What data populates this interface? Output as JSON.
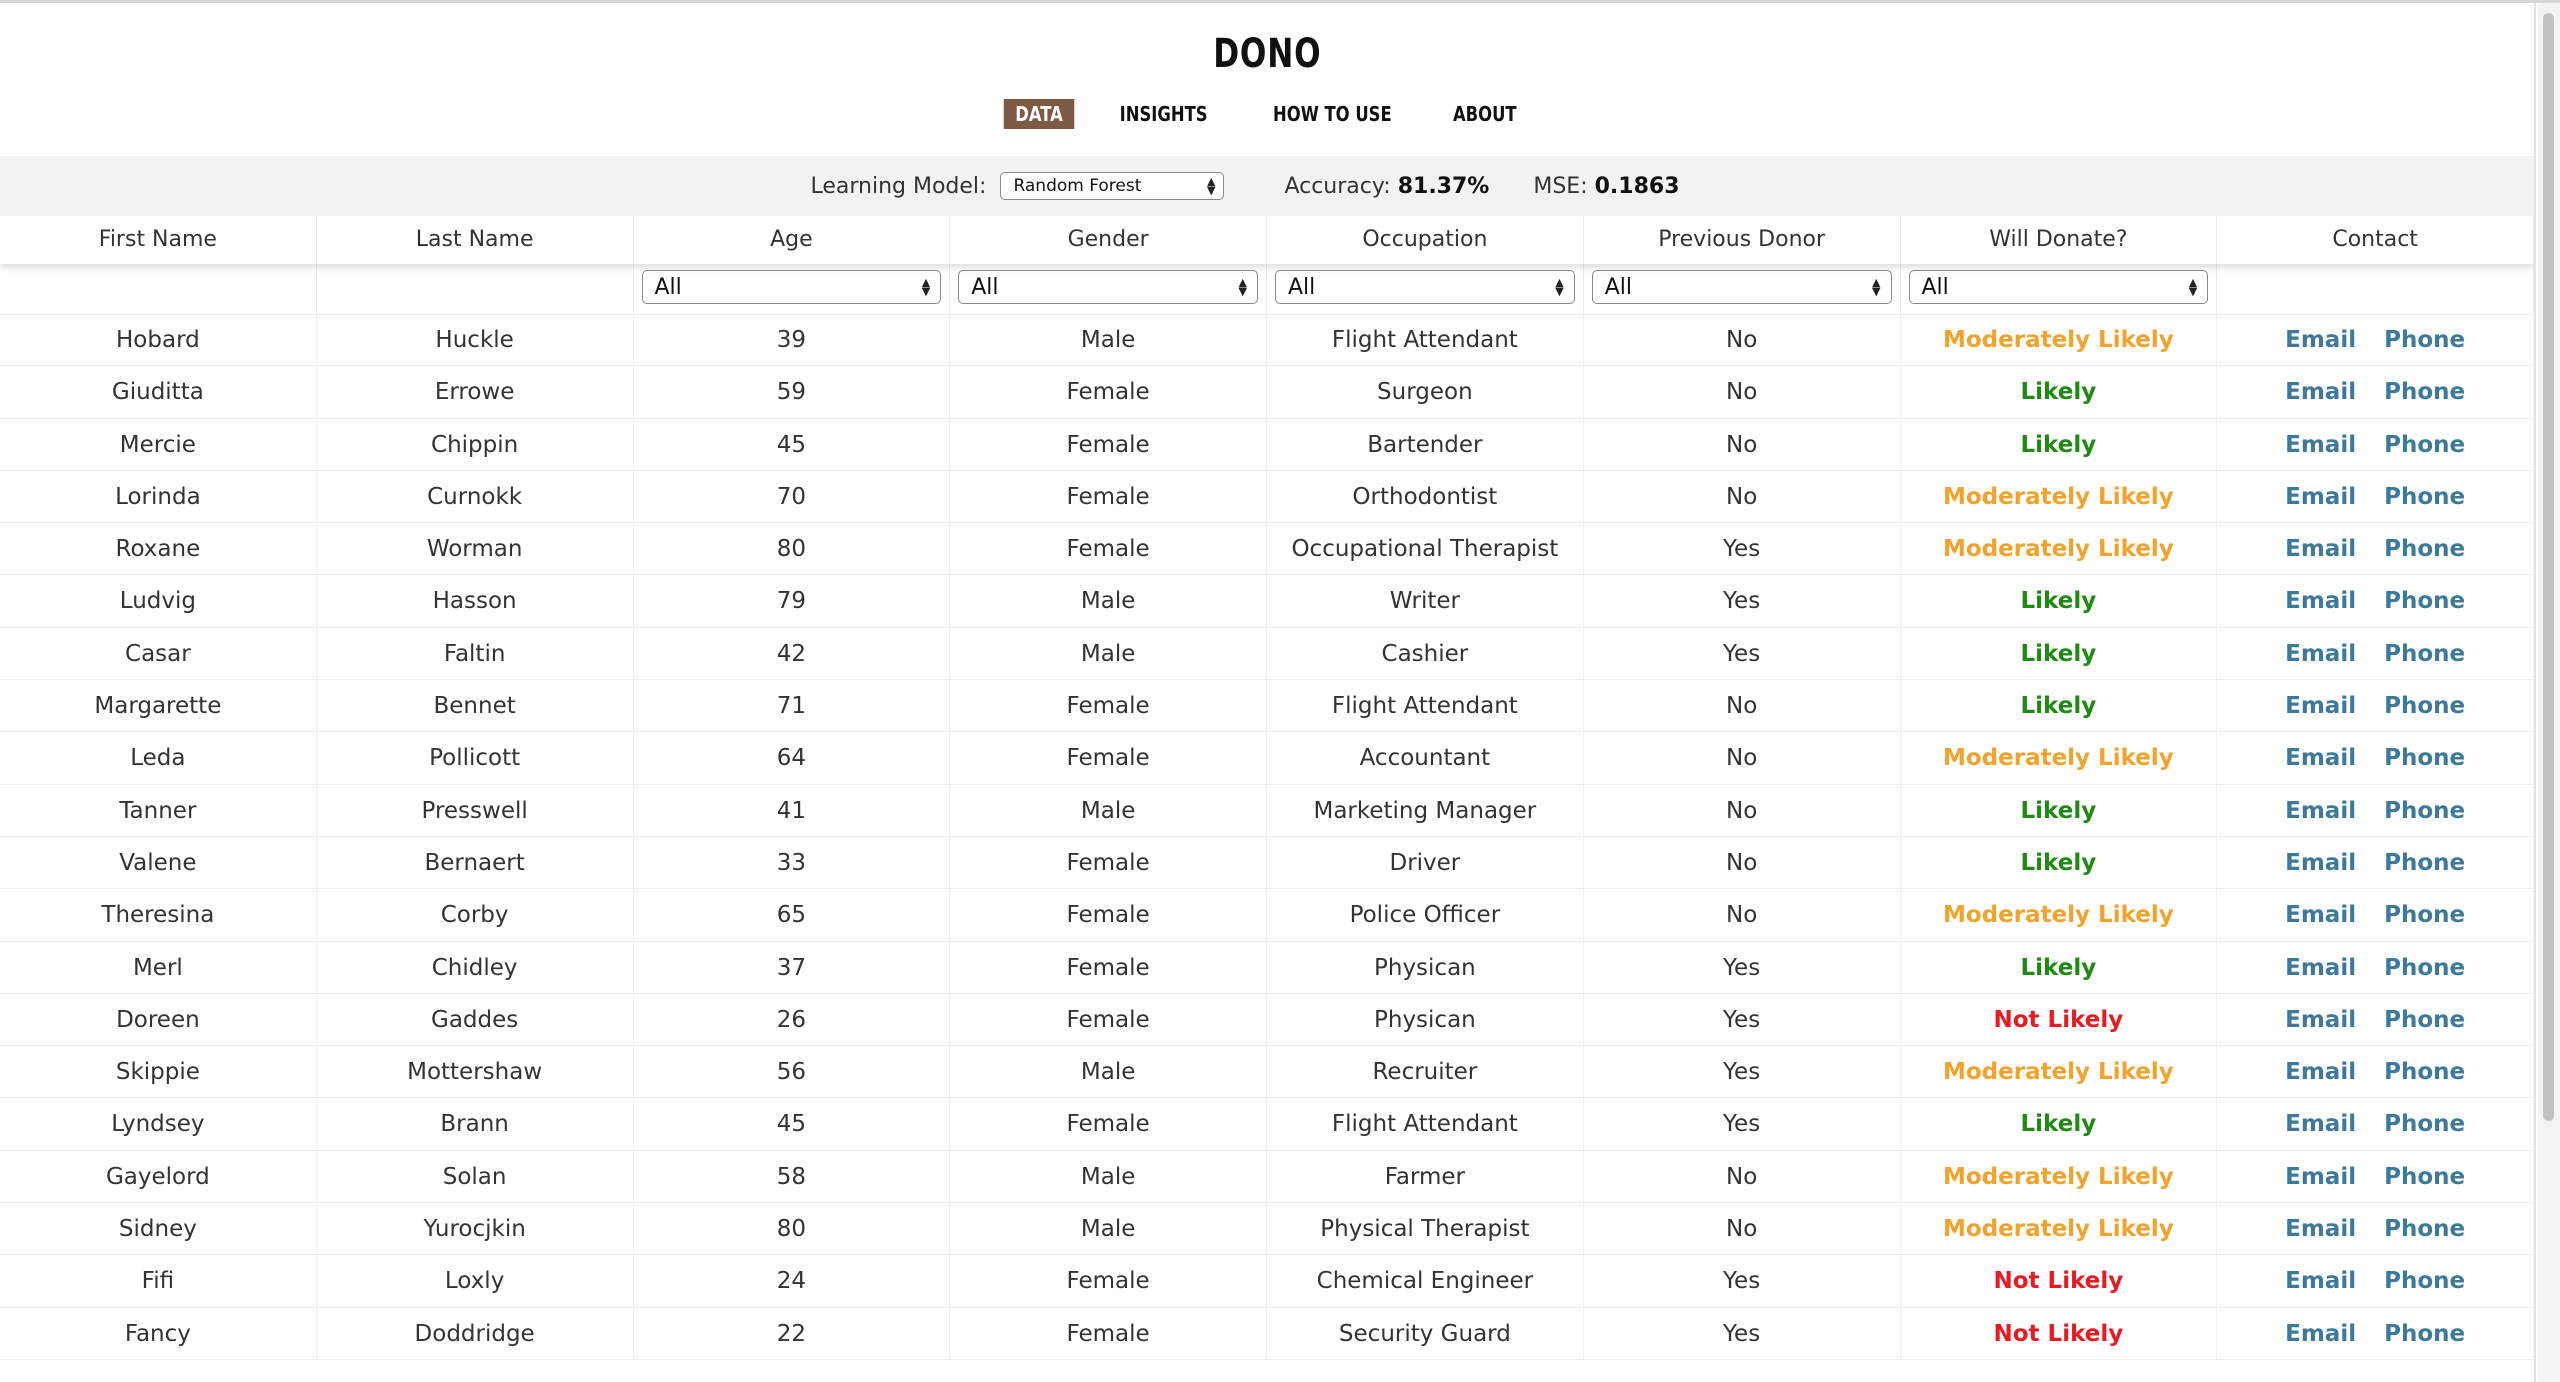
{
  "app": {
    "brand": "DONO",
    "tabs": [
      "DATA",
      "INSIGHTS",
      "HOW TO USE",
      "ABOUT"
    ],
    "active_tab": "DATA"
  },
  "model_bar": {
    "model_label": "Learning Model:",
    "model_value": "Random Forest",
    "accuracy_label": "Accuracy:",
    "accuracy_value": "81.37%",
    "mse_label": "MSE:",
    "mse_value": "0.1863"
  },
  "table": {
    "columns": [
      "First Name",
      "Last Name",
      "Age",
      "Gender",
      "Occupation",
      "Previous Donor",
      "Will Donate?",
      "Contact"
    ],
    "filters": {
      "age": "All",
      "gender": "All",
      "occupation": "All",
      "previous_donor": "All",
      "will_donate": "All"
    },
    "contact_labels": {
      "email": "Email",
      "phone": "Phone"
    },
    "rows": [
      {
        "first": "Hobard",
        "last": "Huckle",
        "age": "39",
        "gender": "Male",
        "occupation": "Flight Attendant",
        "prev": "No",
        "will": "Moderately Likely"
      },
      {
        "first": "Giuditta",
        "last": "Errowe",
        "age": "59",
        "gender": "Female",
        "occupation": "Surgeon",
        "prev": "No",
        "will": "Likely"
      },
      {
        "first": "Mercie",
        "last": "Chippin",
        "age": "45",
        "gender": "Female",
        "occupation": "Bartender",
        "prev": "No",
        "will": "Likely"
      },
      {
        "first": "Lorinda",
        "last": "Curnokk",
        "age": "70",
        "gender": "Female",
        "occupation": "Orthodontist",
        "prev": "No",
        "will": "Moderately Likely"
      },
      {
        "first": "Roxane",
        "last": "Worman",
        "age": "80",
        "gender": "Female",
        "occupation": "Occupational Therapist",
        "prev": "Yes",
        "will": "Moderately Likely"
      },
      {
        "first": "Ludvig",
        "last": "Hasson",
        "age": "79",
        "gender": "Male",
        "occupation": "Writer",
        "prev": "Yes",
        "will": "Likely"
      },
      {
        "first": "Casar",
        "last": "Faltin",
        "age": "42",
        "gender": "Male",
        "occupation": "Cashier",
        "prev": "Yes",
        "will": "Likely"
      },
      {
        "first": "Margarette",
        "last": "Bennet",
        "age": "71",
        "gender": "Female",
        "occupation": "Flight Attendant",
        "prev": "No",
        "will": "Likely"
      },
      {
        "first": "Leda",
        "last": "Pollicott",
        "age": "64",
        "gender": "Female",
        "occupation": "Accountant",
        "prev": "No",
        "will": "Moderately Likely"
      },
      {
        "first": "Tanner",
        "last": "Presswell",
        "age": "41",
        "gender": "Male",
        "occupation": "Marketing Manager",
        "prev": "No",
        "will": "Likely"
      },
      {
        "first": "Valene",
        "last": "Bernaert",
        "age": "33",
        "gender": "Female",
        "occupation": "Driver",
        "prev": "No",
        "will": "Likely"
      },
      {
        "first": "Theresina",
        "last": "Corby",
        "age": "65",
        "gender": "Female",
        "occupation": "Police Officer",
        "prev": "No",
        "will": "Moderately Likely"
      },
      {
        "first": "Merl",
        "last": "Chidley",
        "age": "37",
        "gender": "Female",
        "occupation": "Physican",
        "prev": "Yes",
        "will": "Likely"
      },
      {
        "first": "Doreen",
        "last": "Gaddes",
        "age": "26",
        "gender": "Female",
        "occupation": "Physican",
        "prev": "Yes",
        "will": "Not Likely"
      },
      {
        "first": "Skippie",
        "last": "Mottershaw",
        "age": "56",
        "gender": "Male",
        "occupation": "Recruiter",
        "prev": "Yes",
        "will": "Moderately Likely"
      },
      {
        "first": "Lyndsey",
        "last": "Brann",
        "age": "45",
        "gender": "Female",
        "occupation": "Flight Attendant",
        "prev": "Yes",
        "will": "Likely"
      },
      {
        "first": "Gayelord",
        "last": "Solan",
        "age": "58",
        "gender": "Male",
        "occupation": "Farmer",
        "prev": "No",
        "will": "Moderately Likely"
      },
      {
        "first": "Sidney",
        "last": "Yurocjkin",
        "age": "80",
        "gender": "Male",
        "occupation": "Physical Therapist",
        "prev": "No",
        "will": "Moderately Likely"
      },
      {
        "first": "Fifi",
        "last": "Loxly",
        "age": "24",
        "gender": "Female",
        "occupation": "Chemical Engineer",
        "prev": "Yes",
        "will": "Not Likely"
      },
      {
        "first": "Fancy",
        "last": "Doddridge",
        "age": "22",
        "gender": "Female",
        "occupation": "Security Guard",
        "prev": "Yes",
        "will": "Not Likely"
      }
    ]
  },
  "colors": {
    "active_tab": "#7d5a44",
    "likely": "#1e8a12",
    "moderately_likely": "#f2a32b",
    "not_likely": "#ea1a23",
    "contact_link": "#3d7a9a"
  }
}
